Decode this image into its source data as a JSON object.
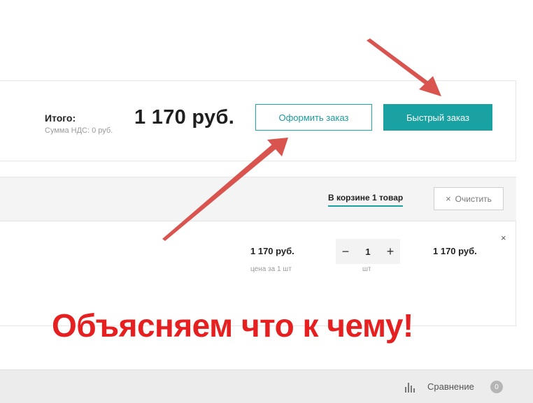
{
  "summary": {
    "total_label": "Итого:",
    "vat_label": "Сумма НДС: 0 руб.",
    "total_price": "1 170 руб.",
    "checkout_button": "Оформить заказ",
    "quick_order_button": "Быстрый заказ"
  },
  "cart": {
    "count_label": "В корзине 1 товар",
    "clear_icon": "×",
    "clear_label": "Очистить"
  },
  "item": {
    "unit_price": "1 170 руб.",
    "unit_caption": "цена за 1 шт",
    "minus": "−",
    "quantity": "1",
    "plus": "+",
    "qty_caption": "шт",
    "line_total": "1 170 руб.",
    "remove": "×"
  },
  "annotation": {
    "headline": "Объясняем что к чему!"
  },
  "footer": {
    "compare_icon": "bar-chart-icon",
    "compare_label": "Сравнение",
    "compare_count": "0"
  },
  "colors": {
    "accent": "#1aa2a2",
    "headline_red": "#e62020",
    "arrow_red": "#d9534f"
  }
}
